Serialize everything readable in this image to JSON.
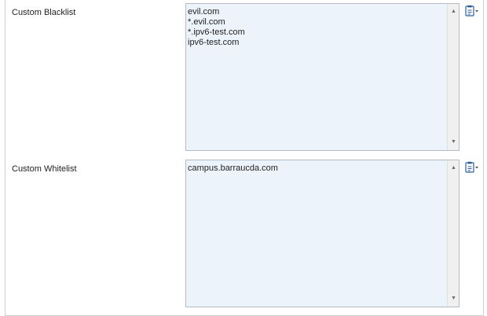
{
  "blacklist": {
    "label": "Custom Blacklist",
    "lines": [
      "evil.com",
      "*.evil.com",
      "*.ipv6-test.com",
      "ipv6-test.com"
    ],
    "clipboard_icon": "clipboard-dropdown-icon"
  },
  "whitelist": {
    "label": "Custom Whitelist",
    "lines": [
      "campus.barraucda.com"
    ],
    "clipboard_icon": "clipboard-dropdown-icon"
  },
  "colors": {
    "textarea_bg": "#edf3fb",
    "textarea_border": "#b5bcc5",
    "icon_blue": "#2e5f9c"
  }
}
